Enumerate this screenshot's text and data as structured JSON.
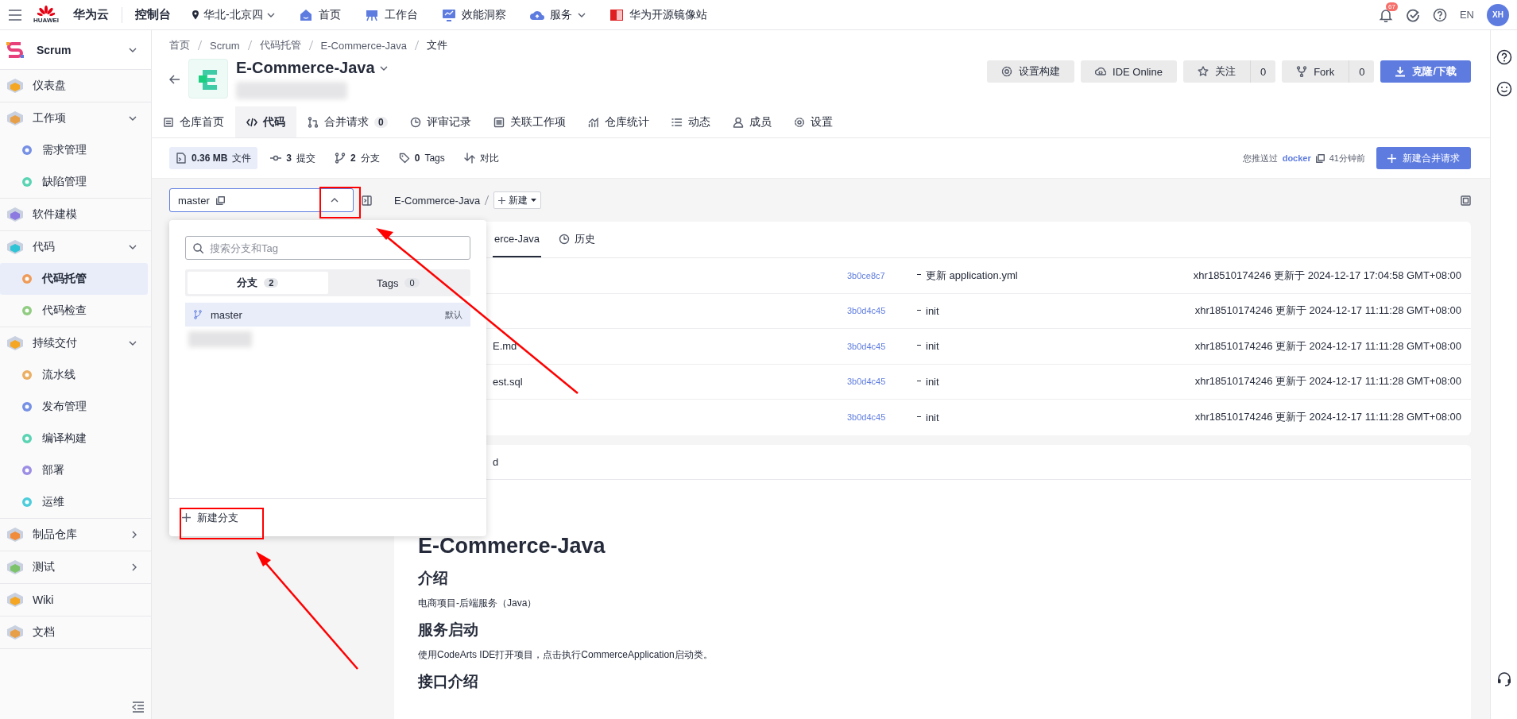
{
  "top_bar": {
    "logo_text": "HUAWEI",
    "brand": "华为云",
    "console": "控制台",
    "region": "华北-北京四",
    "nav": [
      {
        "label": "首页",
        "dropdown": false
      },
      {
        "label": "工作台",
        "dropdown": false
      },
      {
        "label": "效能洞察",
        "dropdown": false
      },
      {
        "label": "服务",
        "dropdown": true
      },
      {
        "label": "华为开源镜像站",
        "dropdown": false
      }
    ],
    "notification_count": "67",
    "language": "EN",
    "avatar": "XH"
  },
  "sidebar": {
    "project": "Scrum",
    "items": [
      {
        "label": "仪表盘",
        "selected": false
      },
      {
        "label": "工作项",
        "selected": false,
        "expanded": true,
        "children": [
          {
            "label": "需求管理",
            "selected": false
          },
          {
            "label": "缺陷管理",
            "selected": false
          }
        ]
      },
      {
        "label": "软件建模",
        "selected": false
      },
      {
        "label": "代码",
        "selected": false,
        "expanded": true,
        "children": [
          {
            "label": "代码托管",
            "selected": true
          },
          {
            "label": "代码检查",
            "selected": false
          }
        ]
      },
      {
        "label": "持续交付",
        "selected": false,
        "expanded": true,
        "children": [
          {
            "label": "流水线",
            "selected": false
          },
          {
            "label": "发布管理",
            "selected": false
          },
          {
            "label": "编译构建",
            "selected": false
          },
          {
            "label": "部署",
            "selected": false
          },
          {
            "label": "运维",
            "selected": false
          }
        ]
      },
      {
        "label": "制品仓库",
        "selected": false,
        "expanded": false
      },
      {
        "label": "测试",
        "selected": false,
        "expanded": false
      },
      {
        "label": "Wiki",
        "selected": false
      },
      {
        "label": "文档",
        "selected": false
      }
    ]
  },
  "breadcrumb": [
    "首页",
    "Scrum",
    "代码托管",
    "E-Commerce-Java",
    "文件"
  ],
  "repo": {
    "name": "E-Commerce-Java",
    "actions": [
      {
        "label": "设置构建",
        "kind": "plain"
      },
      {
        "label": "IDE Online",
        "kind": "plain"
      },
      {
        "label": "关注",
        "count": "0",
        "kind": "counter"
      },
      {
        "label": "Fork",
        "count": "0",
        "kind": "counter"
      },
      {
        "label": "克隆/下载",
        "kind": "primary"
      }
    ]
  },
  "tabs": [
    {
      "label": "仓库首页",
      "selected": false
    },
    {
      "label": "代码",
      "selected": true
    },
    {
      "label": "合并请求",
      "count": "0",
      "selected": false
    },
    {
      "label": "评审记录",
      "selected": false
    },
    {
      "label": "关联工作项",
      "selected": false
    },
    {
      "label": "仓库统计",
      "selected": false
    },
    {
      "label": "动态",
      "selected": false
    },
    {
      "label": "成员",
      "selected": false
    },
    {
      "label": "设置",
      "selected": false
    }
  ],
  "stats": [
    {
      "value": "0.36 MB",
      "label": "文件",
      "selected": true
    },
    {
      "value": "3",
      "label": "提交",
      "selected": false
    },
    {
      "value": "2",
      "label": "分支",
      "selected": false
    },
    {
      "value": "0",
      "label": "Tags",
      "selected": false
    },
    {
      "label": "对比",
      "selected": false
    }
  ],
  "push_info": {
    "prefix": "您推送过",
    "branch": "docker",
    "time": "41分钟前"
  },
  "new_merge_request": "新建合并请求",
  "branch_selector": {
    "value": "master",
    "expanded": true
  },
  "branch_dropdown": {
    "search_placeholder": "搜索分支和Tag",
    "tabs": [
      {
        "label": "分支",
        "count": "2",
        "selected": true
      },
      {
        "label": "Tags",
        "count": "0",
        "selected": false
      }
    ],
    "branches": [
      {
        "name": "master",
        "badge": "默认",
        "selected": true
      }
    ],
    "new_branch": "新建分支"
  },
  "path": {
    "root": "E-Commerce-Java",
    "new_button": "新建"
  },
  "file_panel": {
    "tabs": [
      {
        "label": "erce-Java",
        "selected": true
      },
      {
        "label": "历史",
        "selected": false
      }
    ],
    "rows": [
      {
        "commit": "3b0ce8c7",
        "message": "更新 application.yml",
        "updated": "xhr18510174246 更新于 2024-12-17 17:04:58 GMT+08:00"
      },
      {
        "commit": "3b0d4c45",
        "message": "init",
        "updated": "xhr18510174246 更新于 2024-12-17 11:11:28 GMT+08:00"
      },
      {
        "name": "E.md",
        "commit": "3b0d4c45",
        "message": "init",
        "updated": "xhr18510174246 更新于 2024-12-17 11:11:28 GMT+08:00"
      },
      {
        "name": "est.sql",
        "commit": "3b0d4c45",
        "message": "init",
        "updated": "xhr18510174246 更新于 2024-12-17 11:11:28 GMT+08:00"
      },
      {
        "commit": "3b0d4c45",
        "message": "init",
        "updated": "xhr18510174246 更新于 2024-12-17 11:11:28 GMT+08:00"
      }
    ]
  },
  "readme": {
    "title": "d",
    "blocks": [
      {
        "kind": "h1",
        "text": "E-Commerce-Java"
      },
      {
        "kind": "h2",
        "text": "介绍"
      },
      {
        "kind": "p",
        "text": "电商项目-后端服务（Java）"
      },
      {
        "kind": "h2",
        "text": "服务启动"
      },
      {
        "kind": "p",
        "text": "使用CodeArts IDE打开项目，点击执行CommerceApplication启动类。"
      },
      {
        "kind": "h2",
        "text": "接口介绍"
      }
    ]
  }
}
